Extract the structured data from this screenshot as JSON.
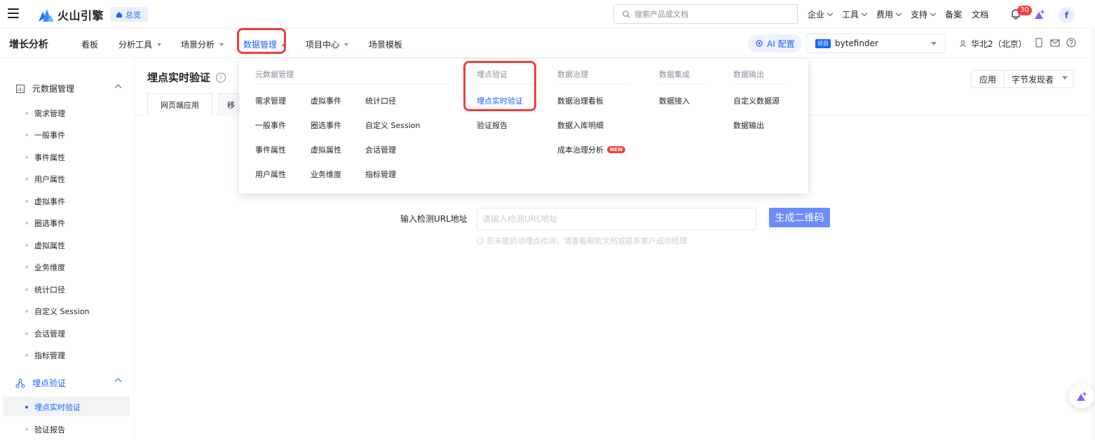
{
  "topbar": {
    "brand": "火山引擎",
    "overview": "总览",
    "search_placeholder": "搜索产品或文档",
    "nav": [
      "企业",
      "工具",
      "费用",
      "支持",
      "备案",
      "文档"
    ],
    "notification_count": "30",
    "avatar": "f"
  },
  "navbar": {
    "product": "增长分析",
    "items": [
      "看板",
      "分析工具",
      "场景分析",
      "数据管理",
      "项目中心",
      "场景模板"
    ],
    "ai_label": "AI 配置",
    "project_tag": "项目",
    "project_name": "bytefinder",
    "region": "华北2（北京）"
  },
  "sidebar": {
    "group1": "元数据管理",
    "group1_items": [
      "需求管理",
      "一般事件",
      "事件属性",
      "用户属性",
      "虚拟事件",
      "圈选事件",
      "虚拟属性",
      "业务维度",
      "统计口径",
      "自定义 Session",
      "会话管理",
      "指标管理"
    ],
    "group2": "埋点验证",
    "group2_items": [
      "埋点实时验证",
      "验证报告"
    ]
  },
  "main": {
    "title": "埋点实时验证",
    "tabs": [
      "网页端应用",
      "移"
    ],
    "apply_label": "应用",
    "apply_value": "字节发现者",
    "url_label": "输入检测URL地址",
    "url_placeholder": "请输入检测URL地址",
    "qr_button": "生成二维码",
    "hint": "若未能启动埋点检测，请查看帮助文档或联系客户成功经理"
  },
  "dropdown": {
    "columns": [
      {
        "header": "元数据管理",
        "items": [
          "需求管理",
          "虚拟事件",
          "统计口径",
          "一般事件",
          "圈选事件",
          "自定义 Session",
          "事件属性",
          "虚拟属性",
          "会话管理",
          "用户属性",
          "业务维度",
          "指标管理"
        ]
      },
      {
        "header": "埋点验证",
        "items": [
          "埋点实时验证",
          "验证报告"
        ]
      },
      {
        "header": "数据治理",
        "items": [
          "数据治理看板",
          "数据入库明细",
          "成本治理分析"
        ],
        "new_badge": "NEW"
      },
      {
        "header": "数据集成",
        "items": [
          "数据接入"
        ]
      },
      {
        "header": "数据输出",
        "items": [
          "自定义数据源",
          "数据输出"
        ]
      }
    ]
  },
  "colors": {
    "accent": "#1664ff",
    "highlight": "#f23d3d",
    "qr_button": "#6b8cff"
  }
}
